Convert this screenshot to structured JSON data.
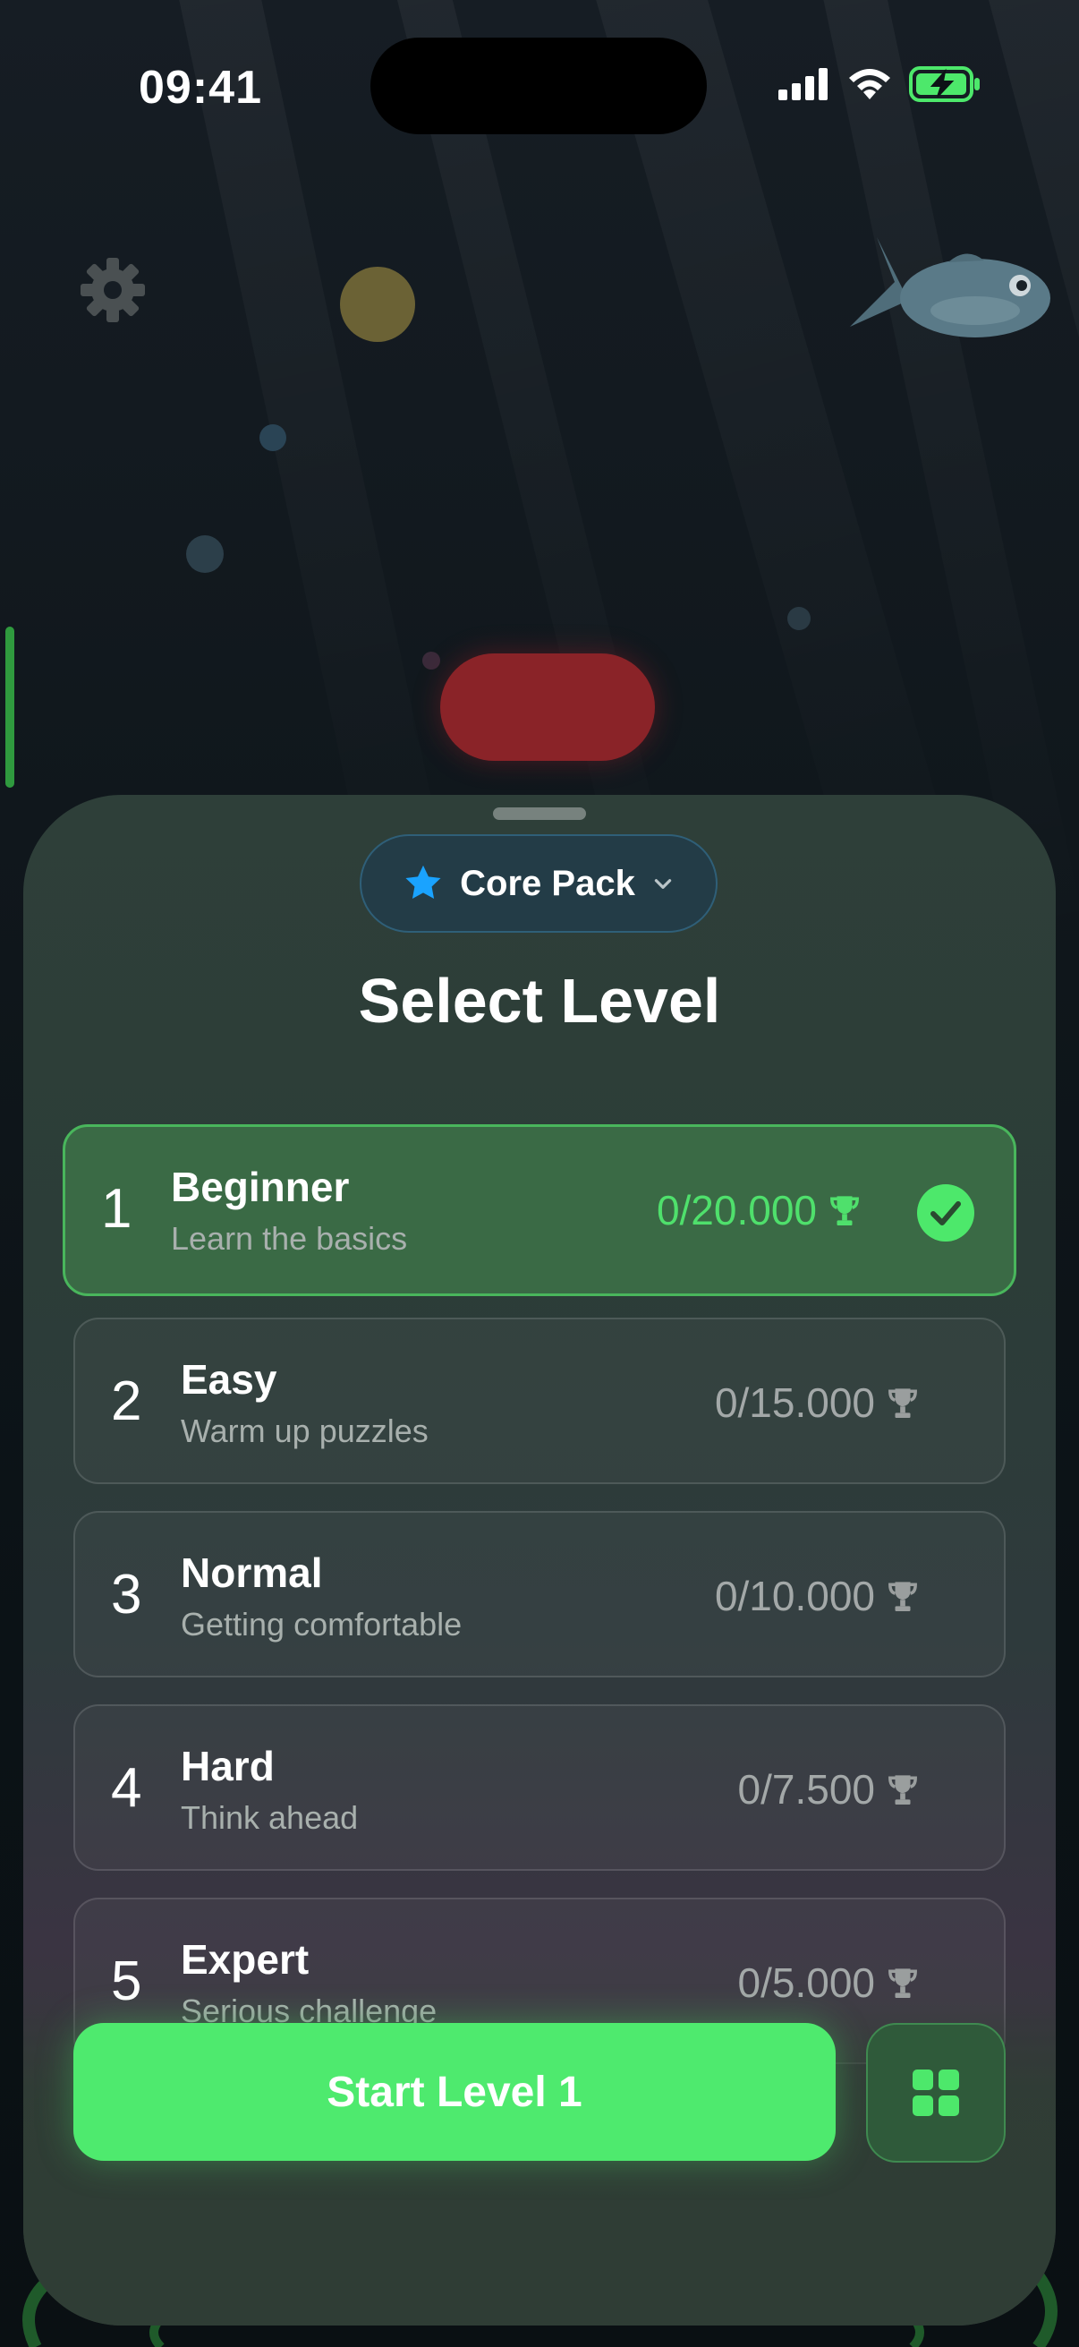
{
  "status_bar": {
    "time": "09:41",
    "icons": [
      "signal-icon",
      "wifi-icon",
      "battery-charging-icon"
    ]
  },
  "background": {
    "icons": [
      "gear-icon",
      "fish-icon"
    ]
  },
  "level_sheet": {
    "pack": {
      "label": "Core Pack",
      "icon": "star-icon",
      "dropdown_icon": "chevron-down-icon"
    },
    "title": "Select Level",
    "levels": [
      {
        "number": "1",
        "name": "Beginner",
        "description": "Learn the basics",
        "score": "0/20.000",
        "selected": true
      },
      {
        "number": "2",
        "name": "Easy",
        "description": "Warm up puzzles",
        "score": "0/15.000",
        "selected": false
      },
      {
        "number": "3",
        "name": "Normal",
        "description": "Getting comfortable",
        "score": "0/10.000",
        "selected": false
      },
      {
        "number": "4",
        "name": "Hard",
        "description": "Think ahead",
        "score": "0/7.500",
        "selected": false
      },
      {
        "number": "5",
        "name": "Expert",
        "description": "Serious challenge",
        "score": "0/5.000",
        "selected": false
      }
    ],
    "start_button_label": "Start Level 1",
    "grid_button_icon": "grid-icon"
  },
  "colors": {
    "accent_green": "#4eea6e",
    "selected_row": "#3a6a45",
    "pack_pill": "#233c47",
    "star_blue": "#1aa3ff",
    "red_pill": "#8a2328"
  }
}
